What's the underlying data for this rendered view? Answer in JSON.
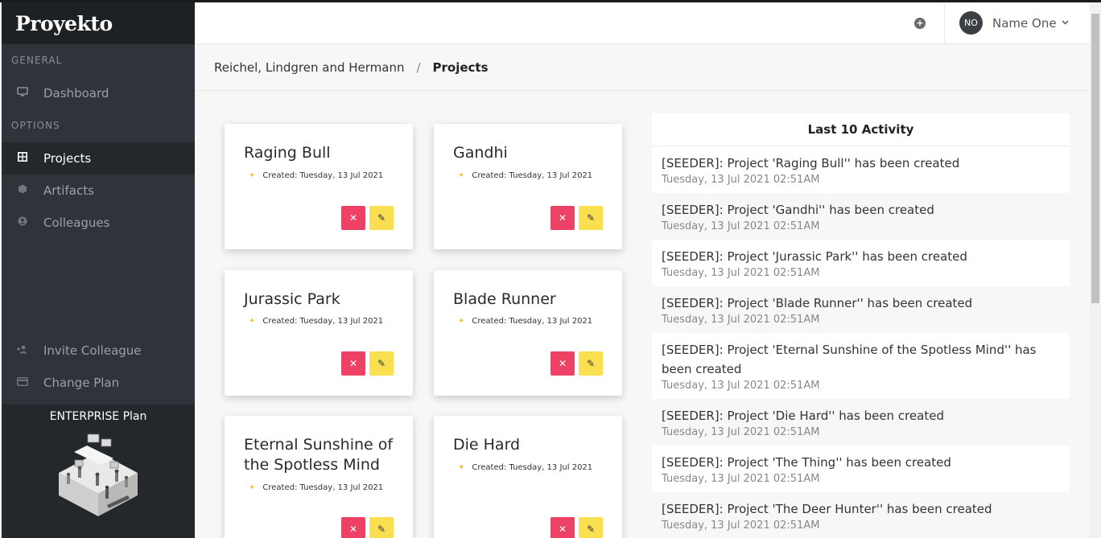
{
  "app": {
    "brand": "Proyekto"
  },
  "sidebar": {
    "section_general": "GENERAL",
    "section_options": "OPTIONS",
    "items": [
      {
        "label": "Dashboard",
        "icon": "monitor-icon"
      },
      {
        "label": "Projects",
        "icon": "grid-icon",
        "active": true
      },
      {
        "label": "Artifacts",
        "icon": "hexagon-icon"
      },
      {
        "label": "Colleagues",
        "icon": "user-circle-icon"
      }
    ],
    "bottom_items": [
      {
        "label": "Invite Colleague",
        "icon": "user-plus-icon"
      },
      {
        "label": "Change Plan",
        "icon": "credit-card-icon"
      }
    ],
    "plan_label": "ENTERPRISE Plan"
  },
  "topbar": {
    "add_icon": "plus-circle-icon",
    "user_initials": "NO",
    "user_name": "Name One"
  },
  "breadcrumb": {
    "parent": "Reichel, Lindgren and Hermann",
    "separator": "/",
    "current": "Projects"
  },
  "projects": [
    {
      "title": "Raging Bull",
      "created": "Created: Tuesday, 13 Jul 2021"
    },
    {
      "title": "Gandhi",
      "created": "Created: Tuesday, 13 Jul 2021"
    },
    {
      "title": "Jurassic Park",
      "created": "Created: Tuesday, 13 Jul 2021"
    },
    {
      "title": "Blade Runner",
      "created": "Created: Tuesday, 13 Jul 2021"
    },
    {
      "title": "Eternal Sunshine of the Spotless Mind",
      "created": "Created: Tuesday, 13 Jul 2021"
    },
    {
      "title": "Die Hard",
      "created": "Created: Tuesday, 13 Jul 2021"
    }
  ],
  "card_buttons": {
    "delete": "✕",
    "edit": "✎"
  },
  "activity": {
    "title": "Last 10 Activity",
    "items": [
      {
        "text": "[SEEDER]: Project 'Raging Bull'' has been created",
        "date": "Tuesday, 13 Jul 2021 02:51AM"
      },
      {
        "text": "[SEEDER]: Project 'Gandhi'' has been created",
        "date": "Tuesday, 13 Jul 2021 02:51AM"
      },
      {
        "text": "[SEEDER]: Project 'Jurassic Park'' has been created",
        "date": "Tuesday, 13 Jul 2021 02:51AM"
      },
      {
        "text": "[SEEDER]: Project 'Blade Runner'' has been created",
        "date": "Tuesday, 13 Jul 2021 02:51AM"
      },
      {
        "text": "[SEEDER]: Project 'Eternal Sunshine of the Spotless Mind'' has been created",
        "date": "Tuesday, 13 Jul 2021 02:51AM"
      },
      {
        "text": "[SEEDER]: Project 'Die Hard'' has been created",
        "date": "Tuesday, 13 Jul 2021 02:51AM"
      },
      {
        "text": "[SEEDER]: Project 'The Thing'' has been created",
        "date": "Tuesday, 13 Jul 2021 02:51AM"
      },
      {
        "text": "[SEEDER]: Project 'The Deer Hunter'' has been created",
        "date": "Tuesday, 13 Jul 2021 02:51AM"
      }
    ]
  },
  "colors": {
    "sidebar_bg": "#2f343a",
    "delete": "#ed4165",
    "edit": "#fadf50",
    "star": "#f0c53a"
  }
}
